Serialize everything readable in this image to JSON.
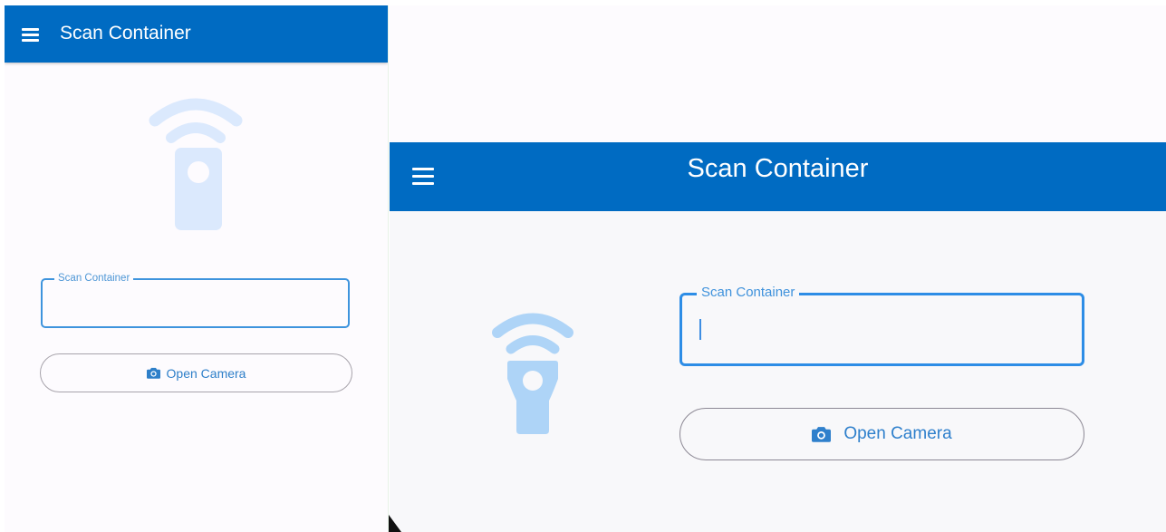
{
  "colors": {
    "app_bar": "#006bc2",
    "background": "#fdfbfe",
    "accent": "#2d8de6",
    "illustration": "#aed4f7",
    "button_text": "#2f80cc"
  },
  "portrait": {
    "app_bar": {
      "title": "Scan Container",
      "menu_icon": "hamburger-menu-icon"
    },
    "illustration_icon": "barcode-scanner-icon",
    "scan_field": {
      "label": "Scan Container",
      "value": ""
    },
    "camera_button": {
      "label": "Open Camera",
      "icon": "camera-icon"
    }
  },
  "landscape": {
    "app_bar": {
      "title": "Scan Container",
      "menu_icon": "hamburger-menu-icon"
    },
    "illustration_icon": "barcode-scanner-icon",
    "scan_field": {
      "label": "Scan Container",
      "value": ""
    },
    "camera_button": {
      "label": "Open Camera",
      "icon": "camera-icon"
    }
  }
}
